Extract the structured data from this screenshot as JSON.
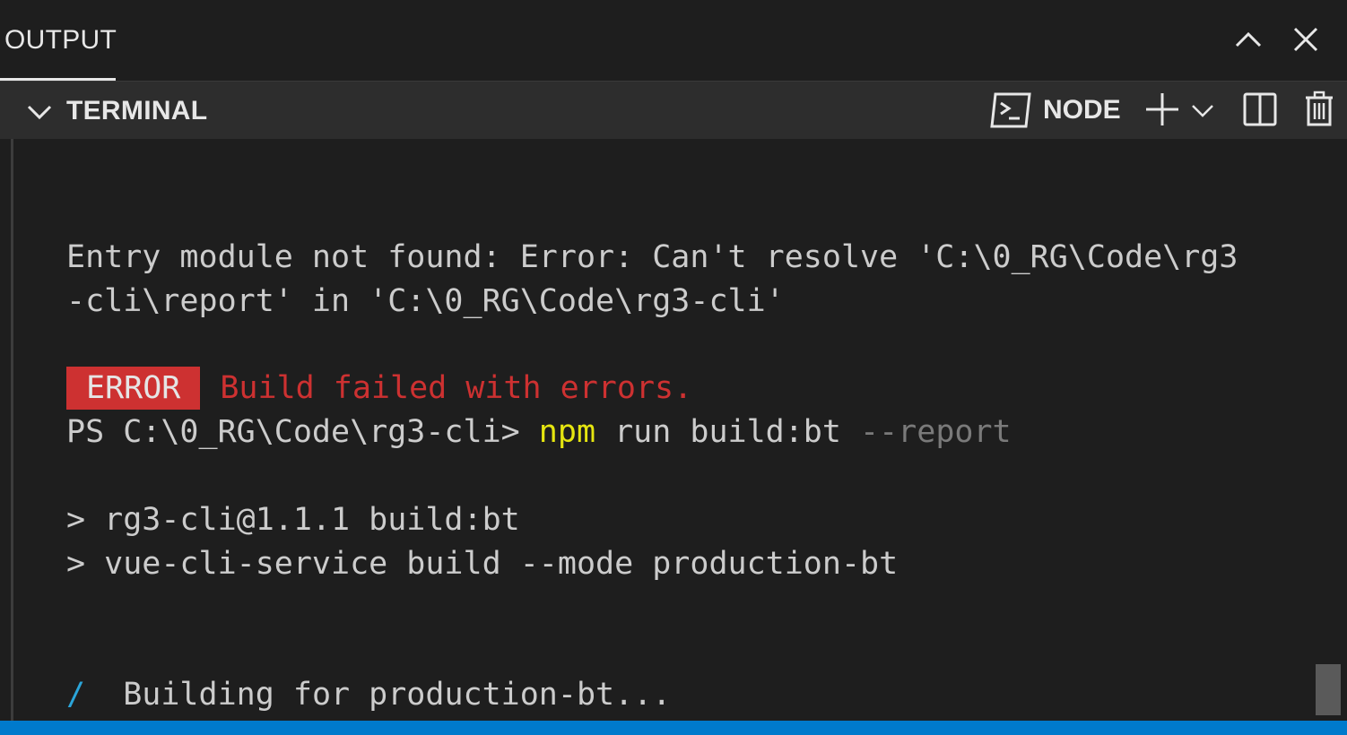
{
  "panel": {
    "output_tab": "OUTPUT",
    "maximize_icon": "chevron-up-icon",
    "close_icon": "close-icon"
  },
  "terminal_header": {
    "collapse_icon": "chevron-down-icon",
    "title": "TERMINAL",
    "shell_icon": "terminal-icon",
    "shell_name": "NODE",
    "add_icon": "plus-icon",
    "dropdown_icon": "chevron-down-icon",
    "split_icon": "split-icon",
    "trash_icon": "trash-icon"
  },
  "terminal": {
    "line1": "Entry module not found: Error: Can't resolve 'C:\\0_RG\\Code\\rg3",
    "line2": "-cli\\report' in 'C:\\0_RG\\Code\\rg3-cli'",
    "error_badge": "ERROR",
    "error_message": "Build failed with errors.",
    "prompt": "PS C:\\0_RG\\Code\\rg3-cli> ",
    "command_name": "npm",
    "command_args": " run build:bt ",
    "command_flag": "--report",
    "script_line1": "> rg3-cli@1.1.1 build:bt",
    "script_line2": "> vue-cli-service build --mode production-bt",
    "spinner": "/",
    "building": "  Building for production-bt..."
  },
  "colors": {
    "background": "#1e1e1e",
    "header": "#2d2d2d",
    "error": "#cd3131",
    "command": "#e5e510",
    "spinner": "#2ba5d9",
    "statusbar": "#007acc"
  }
}
